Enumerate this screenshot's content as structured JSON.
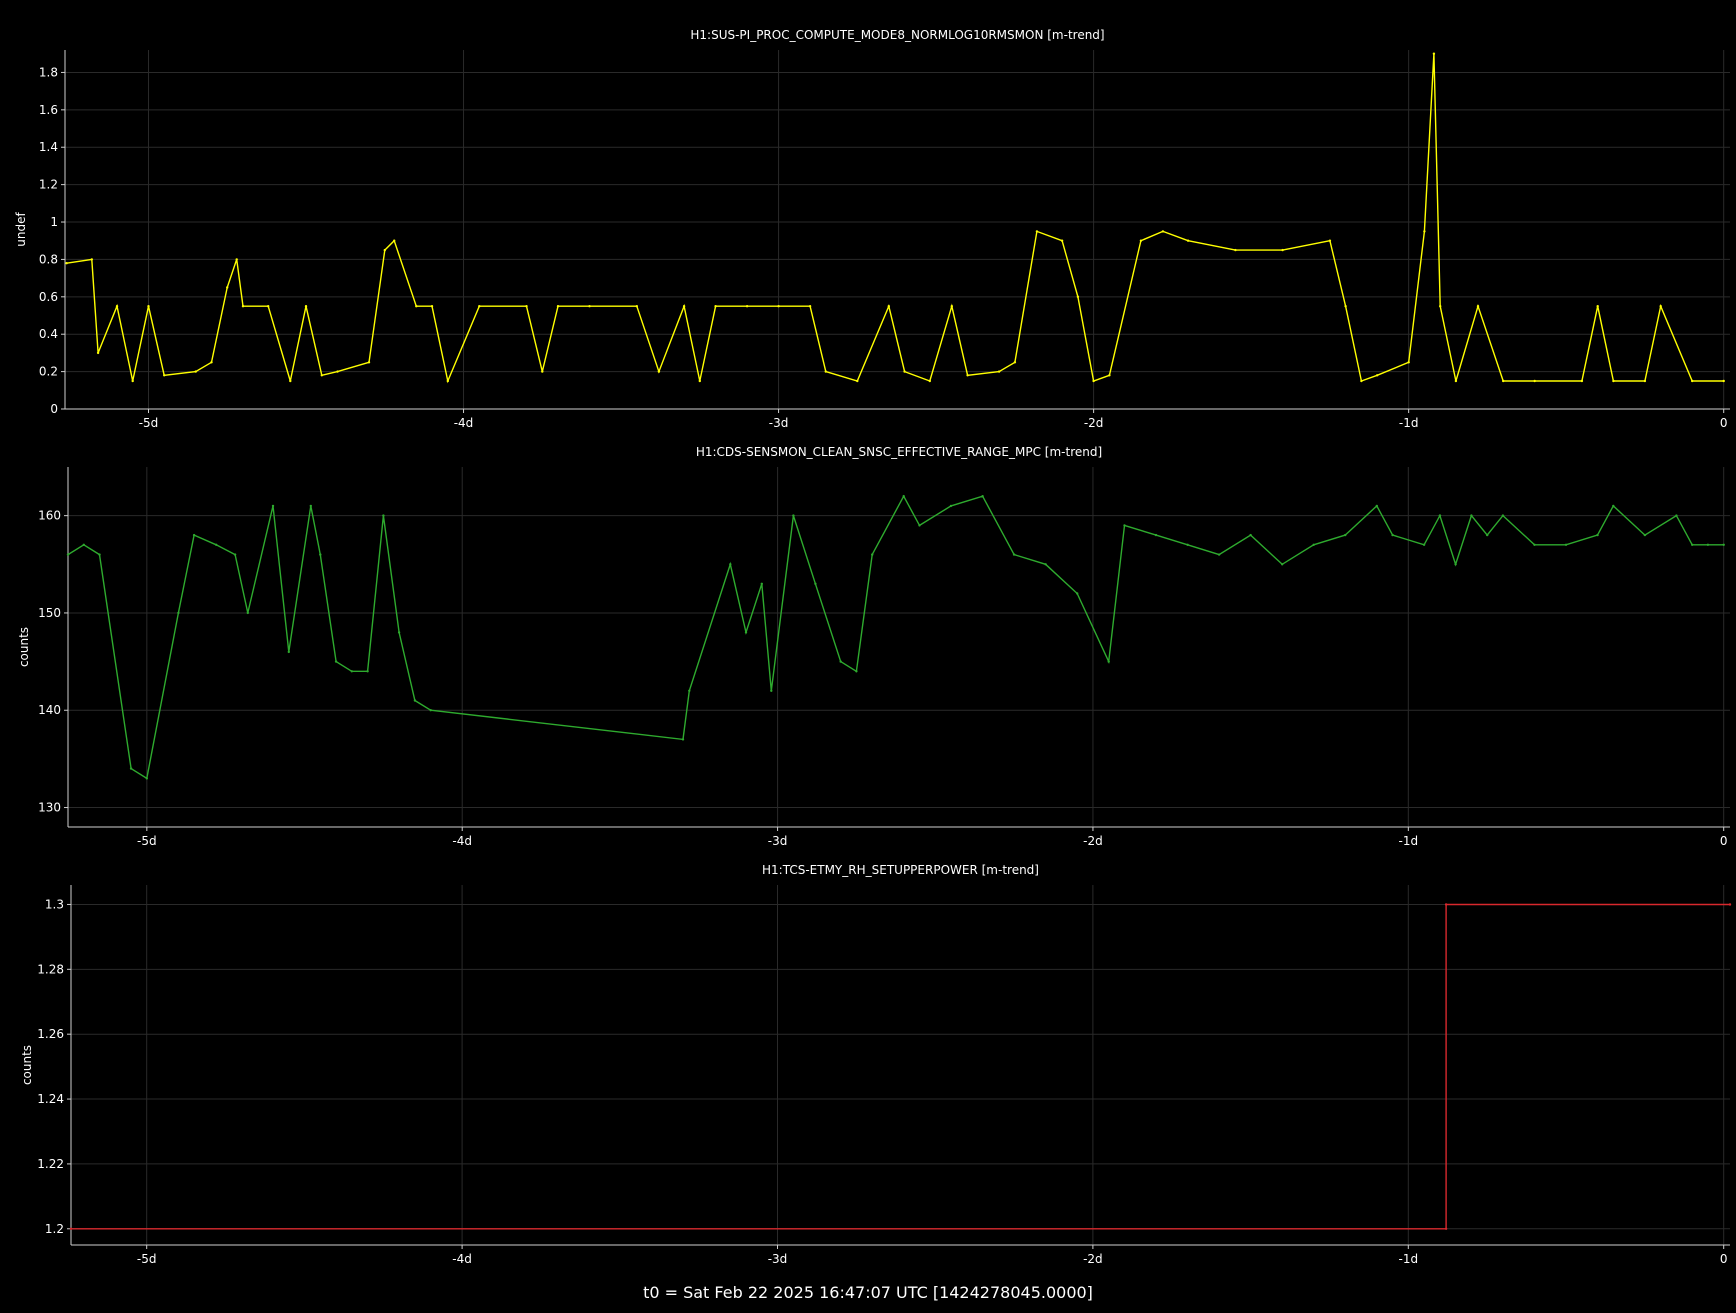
{
  "footer": "t0 = Sat Feb 22 2025 16:47:07 UTC [1424278045.0000]",
  "chart_data": [
    {
      "type": "line",
      "title": "H1:SUS-PI_PROC_COMPUTE_MODE8_NORMLOG10RMSMON [m-trend]",
      "ylabel": "undef",
      "xlabel": "",
      "color": "#ffff00",
      "xlim": [
        -5.265,
        0.02
      ],
      "ylim": [
        0,
        1.92
      ],
      "xticks": [
        {
          "v": -5,
          "label": "-5d"
        },
        {
          "v": -4,
          "label": "-4d"
        },
        {
          "v": -3,
          "label": "-3d"
        },
        {
          "v": -2,
          "label": "-2d"
        },
        {
          "v": -1,
          "label": "-1d"
        },
        {
          "v": 0,
          "label": "0"
        }
      ],
      "yticks": [
        {
          "v": 0,
          "label": "0"
        },
        {
          "v": 0.2,
          "label": "0.2"
        },
        {
          "v": 0.4,
          "label": "0.4"
        },
        {
          "v": 0.6,
          "label": "0.6"
        },
        {
          "v": 0.8,
          "label": "0.8"
        },
        {
          "v": 1,
          "label": "1"
        },
        {
          "v": 1.2,
          "label": "1.2"
        },
        {
          "v": 1.4,
          "label": "1.4"
        },
        {
          "v": 1.6,
          "label": "1.6"
        },
        {
          "v": 1.8,
          "label": "1.8"
        }
      ],
      "grid": true,
      "series": [
        {
          "x": [
            -5.26,
            -5.18,
            -5.16,
            -5.1,
            -5.05,
            -5.0,
            -4.95,
            -4.85,
            -4.8,
            -4.75,
            -4.72,
            -4.7,
            -4.62,
            -4.55,
            -4.5,
            -4.45,
            -4.4,
            -4.3,
            -4.25,
            -4.22,
            -4.15,
            -4.1,
            -4.05,
            -3.95,
            -3.8,
            -3.75,
            -3.7,
            -3.6,
            -3.45,
            -3.38,
            -3.3,
            -3.25,
            -3.2,
            -3.1,
            -3.0,
            -2.9,
            -2.85,
            -2.75,
            -2.65,
            -2.6,
            -2.52,
            -2.45,
            -2.4,
            -2.3,
            -2.25,
            -2.18,
            -2.1,
            -2.05,
            -2.0,
            -1.95,
            -1.85,
            -1.78,
            -1.7,
            -1.55,
            -1.4,
            -1.25,
            -1.2,
            -1.15,
            -1.1,
            -1.0,
            -0.95,
            -0.92,
            -0.9,
            -0.85,
            -0.78,
            -0.7,
            -0.6,
            -0.45,
            -0.4,
            -0.35,
            -0.25,
            -0.2,
            -0.1,
            0.0
          ],
          "y": [
            0.78,
            0.8,
            0.3,
            0.55,
            0.15,
            0.55,
            0.18,
            0.2,
            0.25,
            0.65,
            0.8,
            0.55,
            0.55,
            0.15,
            0.55,
            0.18,
            0.2,
            0.25,
            0.85,
            0.9,
            0.55,
            0.55,
            0.15,
            0.55,
            0.55,
            0.2,
            0.55,
            0.55,
            0.55,
            0.2,
            0.55,
            0.15,
            0.55,
            0.55,
            0.55,
            0.55,
            0.2,
            0.15,
            0.55,
            0.2,
            0.15,
            0.55,
            0.18,
            0.2,
            0.25,
            0.95,
            0.9,
            0.6,
            0.15,
            0.18,
            0.9,
            0.95,
            0.9,
            0.85,
            0.85,
            0.9,
            0.55,
            0.15,
            0.18,
            0.25,
            0.95,
            1.9,
            0.55,
            0.15,
            0.55,
            0.15,
            0.15,
            0.15,
            0.55,
            0.15,
            0.15,
            0.55,
            0.15,
            0.15
          ]
        }
      ]
    },
    {
      "type": "line",
      "title": "H1:CDS-SENSMON_CLEAN_SNSC_EFFECTIVE_RANGE_MPC [m-trend]",
      "ylabel": "counts",
      "xlabel": "",
      "color": "#2eaa2e",
      "xlim": [
        -5.25,
        0.02
      ],
      "ylim": [
        128,
        165
      ],
      "xticks": [
        {
          "v": -5,
          "label": "-5d"
        },
        {
          "v": -4,
          "label": "-4d"
        },
        {
          "v": -3,
          "label": "-3d"
        },
        {
          "v": -2,
          "label": "-2d"
        },
        {
          "v": -1,
          "label": "-1d"
        },
        {
          "v": 0,
          "label": "0"
        }
      ],
      "yticks": [
        {
          "v": 130,
          "label": "130"
        },
        {
          "v": 140,
          "label": "140"
        },
        {
          "v": 150,
          "label": "150"
        },
        {
          "v": 160,
          "label": "160"
        }
      ],
      "grid": true,
      "series": [
        {
          "x": [
            -5.25,
            -5.2,
            -5.15,
            -5.05,
            -5.0,
            -4.9,
            -4.85,
            -4.78,
            -4.72,
            -4.68,
            -4.6,
            -4.55,
            -4.48,
            -4.45,
            -4.4,
            -4.35,
            -4.3,
            -4.25,
            -4.2,
            -4.15,
            -4.1,
            -3.3,
            -3.28,
            -3.15,
            -3.1,
            -3.05,
            -3.02,
            -2.95,
            -2.88,
            -2.8,
            -2.75,
            -2.7,
            -2.6,
            -2.55,
            -2.45,
            -2.35,
            -2.25,
            -2.15,
            -2.05,
            -1.95,
            -1.9,
            -1.8,
            -1.7,
            -1.6,
            -1.5,
            -1.4,
            -1.3,
            -1.2,
            -1.1,
            -1.05,
            -0.95,
            -0.9,
            -0.85,
            -0.8,
            -0.75,
            -0.7,
            -0.6,
            -0.5,
            -0.4,
            -0.35,
            -0.25,
            -0.15,
            -0.1,
            -0.05,
            0.0
          ],
          "y": [
            156,
            157,
            156,
            134,
            133,
            150,
            158,
            157,
            156,
            150,
            161,
            146,
            161,
            156,
            145,
            144,
            144,
            160,
            148,
            141,
            140,
            137,
            142,
            155,
            148,
            153,
            142,
            160,
            153,
            145,
            144,
            156,
            162,
            159,
            161,
            162,
            156,
            155,
            152,
            145,
            159,
            158,
            157,
            156,
            158,
            155,
            157,
            158,
            161,
            158,
            157,
            160,
            155,
            160,
            158,
            160,
            157,
            157,
            158,
            161,
            158,
            160,
            157,
            157,
            157
          ]
        }
      ]
    },
    {
      "type": "line",
      "title": "H1:TCS-ETMY_RH_SETUPPERPOWER [m-trend]",
      "ylabel": "counts",
      "xlabel": "",
      "color": "#d8282d",
      "xlim": [
        -5.24,
        0.02
      ],
      "ylim": [
        1.195,
        1.306
      ],
      "xticks": [
        {
          "v": -5,
          "label": "-5d"
        },
        {
          "v": -4,
          "label": "-4d"
        },
        {
          "v": -3,
          "label": "-3d"
        },
        {
          "v": -2,
          "label": "-2d"
        },
        {
          "v": -1,
          "label": "-1d"
        },
        {
          "v": 0,
          "label": "0"
        }
      ],
      "yticks": [
        {
          "v": 1.2,
          "label": "1.2"
        },
        {
          "v": 1.22,
          "label": "1.22"
        },
        {
          "v": 1.24,
          "label": "1.24"
        },
        {
          "v": 1.26,
          "label": "1.26"
        },
        {
          "v": 1.28,
          "label": "1.28"
        },
        {
          "v": 1.3,
          "label": "1.3"
        }
      ],
      "grid": true,
      "series": [
        {
          "x": [
            -5.24,
            -0.88,
            -0.88,
            0.02
          ],
          "y": [
            1.2,
            1.2,
            1.3,
            1.3
          ]
        }
      ]
    }
  ]
}
